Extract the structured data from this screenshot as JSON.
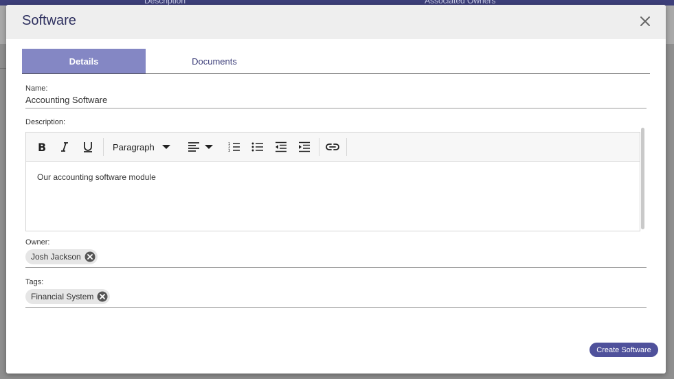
{
  "background": {
    "columns": [
      "Description",
      "Associated Owners"
    ]
  },
  "modal": {
    "title": "Software",
    "tabs": [
      {
        "label": "Details",
        "active": true
      },
      {
        "label": "Documents",
        "active": false
      }
    ],
    "name": {
      "label": "Name:",
      "value": "Accounting Software"
    },
    "description": {
      "label": "Description:",
      "toolbar": {
        "block_format": "Paragraph",
        "buttons": [
          "bold-icon",
          "italic-icon",
          "underline-icon",
          "align-left-icon",
          "numbered-list-icon",
          "bulleted-list-icon",
          "outdent-icon",
          "indent-icon",
          "link-icon"
        ]
      },
      "content": "Our accounting software module"
    },
    "owner": {
      "label": "Owner:",
      "chips": [
        "Josh Jackson"
      ]
    },
    "tags": {
      "label": "Tags:",
      "chips": [
        "Financial System"
      ]
    },
    "create_label": "Create Software"
  },
  "colors": {
    "accent": "#4f519b",
    "tab_active": "#8487c4",
    "header_bg": "#3d3f7a"
  }
}
